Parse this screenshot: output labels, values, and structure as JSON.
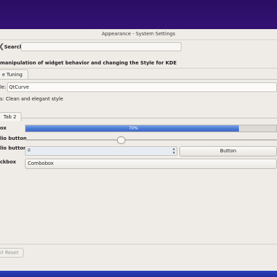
{
  "window": {
    "title": "Appearance - System Settings"
  },
  "toolbar": {
    "search_label": "Search:",
    "search_value": ""
  },
  "module": {
    "description": "manipulation of widget behavior and changing the Style for KDE"
  },
  "tabs": {
    "fine_tuning": "e Tuning"
  },
  "style": {
    "label": "le:",
    "selected": "QtCurve",
    "description": "s: Clean and elegant style"
  },
  "preview": {
    "tab": "Tab 2",
    "checkbox_label": "ox",
    "radio1_label": "lio button",
    "radio2_label": "lio button",
    "checkbox2_label": "ckbox",
    "progress": {
      "value": 70,
      "text": "70%"
    },
    "slider_value": 0.38,
    "spin_value": "0",
    "button_label": "Button",
    "combo_value": "Combobox"
  },
  "footer": {
    "reset_label": "Reset"
  },
  "colors": {
    "progress_fill": "#4a78d3",
    "window_bg": "#efece7"
  }
}
